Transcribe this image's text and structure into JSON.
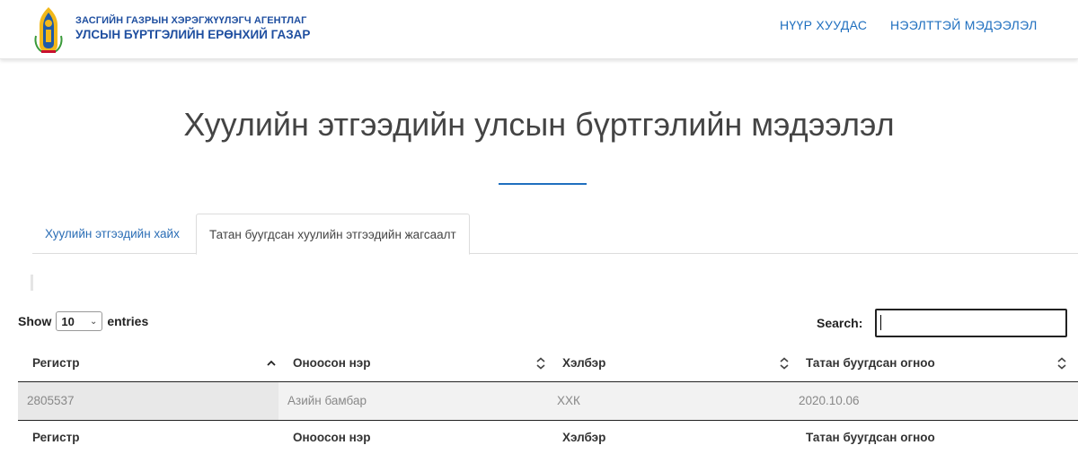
{
  "header": {
    "agency_line1": "ЗАСГИЙН ГАЗРЫН ХЭРЭГЖҮҮЛЭГЧ АГЕНТЛАГ",
    "agency_line2": "УЛСЫН БҮРТГЭЛИЙН ЕРӨНХИЙ ГАЗАР",
    "nav": [
      "НҮҮР ХУУДАС",
      "НЭЭЛТТЭЙ МЭДЭЭЛЭЛ"
    ]
  },
  "page_title": "Хуулийн этгээдийн улсын бүртгэлийн мэдээлэл",
  "tabs": [
    "Хуулийн этгээдийн хайх",
    "Татан буугдсан хуулийн этгээдийн жагсаалт"
  ],
  "table_controls": {
    "show_label": "Show",
    "entries_value": "10",
    "entries_label": "entries",
    "search_label": "Search:",
    "search_value": ""
  },
  "table": {
    "columns": [
      "Регистр",
      "Оноосон нэр",
      "Хэлбэр",
      "Татан буугдсан огноо"
    ],
    "rows": [
      [
        "2805537",
        "Азийн бамбар",
        "ХХК",
        "2020.10.06"
      ]
    ]
  },
  "colors": {
    "brand_blue": "#1f4fa0",
    "link_blue": "#1f6fbf"
  }
}
